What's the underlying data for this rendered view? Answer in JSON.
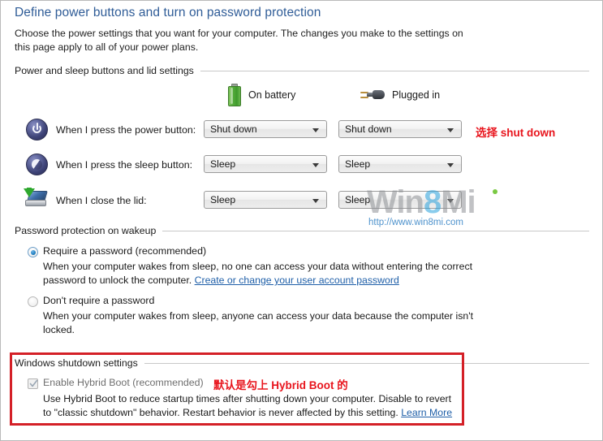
{
  "page": {
    "title": "Define power buttons and turn on password protection",
    "description": "Choose the power settings that you want for your computer. The changes you make to the settings on this page apply to all of your power plans."
  },
  "sections": {
    "power_buttons": {
      "heading": "Power and sleep buttons and lid settings",
      "columns": [
        {
          "icon": "battery-icon",
          "label": "On battery"
        },
        {
          "icon": "plug-icon",
          "label": "Plugged in"
        }
      ],
      "rows": [
        {
          "icon": "power-button-icon",
          "label": "When I press the power button:",
          "on_battery": "Shut down",
          "plugged_in": "Shut down"
        },
        {
          "icon": "sleep-button-icon",
          "label": "When I press the sleep button:",
          "on_battery": "Sleep",
          "plugged_in": "Sleep"
        },
        {
          "icon": "laptop-lid-icon",
          "label": "When I close the lid:",
          "on_battery": "Sleep",
          "plugged_in": "Sleep"
        }
      ]
    },
    "password_protection": {
      "heading": "Password protection on wakeup",
      "options": [
        {
          "title": "Require a password (recommended)",
          "selected": true,
          "body_before_link": "When your computer wakes from sleep, no one can access your data without entering the correct password to unlock the computer. ",
          "link": "Create or change your user account password"
        },
        {
          "title": "Don't require a password",
          "selected": false,
          "body_before_link": "When your computer wakes from sleep, anyone can access your data because the computer isn't locked.",
          "link": ""
        }
      ]
    },
    "shutdown_settings": {
      "heading": "Windows shutdown settings",
      "checkbox": {
        "label": "Enable Hybrid Boot (recommended)",
        "checked": true,
        "disabled": true
      },
      "body_before_link": "Use Hybrid Boot to reduce startup times after shutting down your computer. Disable to revert to \"classic shutdown\" behavior. Restart behavior is never affected by this setting. ",
      "link": "Learn More"
    }
  },
  "annotations": [
    {
      "text": "选择 shut down",
      "color": "#e8151d"
    },
    {
      "text": "默认是勾上 Hybrid Boot 的",
      "color": "#e8151d"
    }
  ],
  "watermark": {
    "brand_part1": "Win",
    "brand_eight": "8",
    "brand_part2": "Mi",
    "url": "http://www.win8mi.com"
  }
}
